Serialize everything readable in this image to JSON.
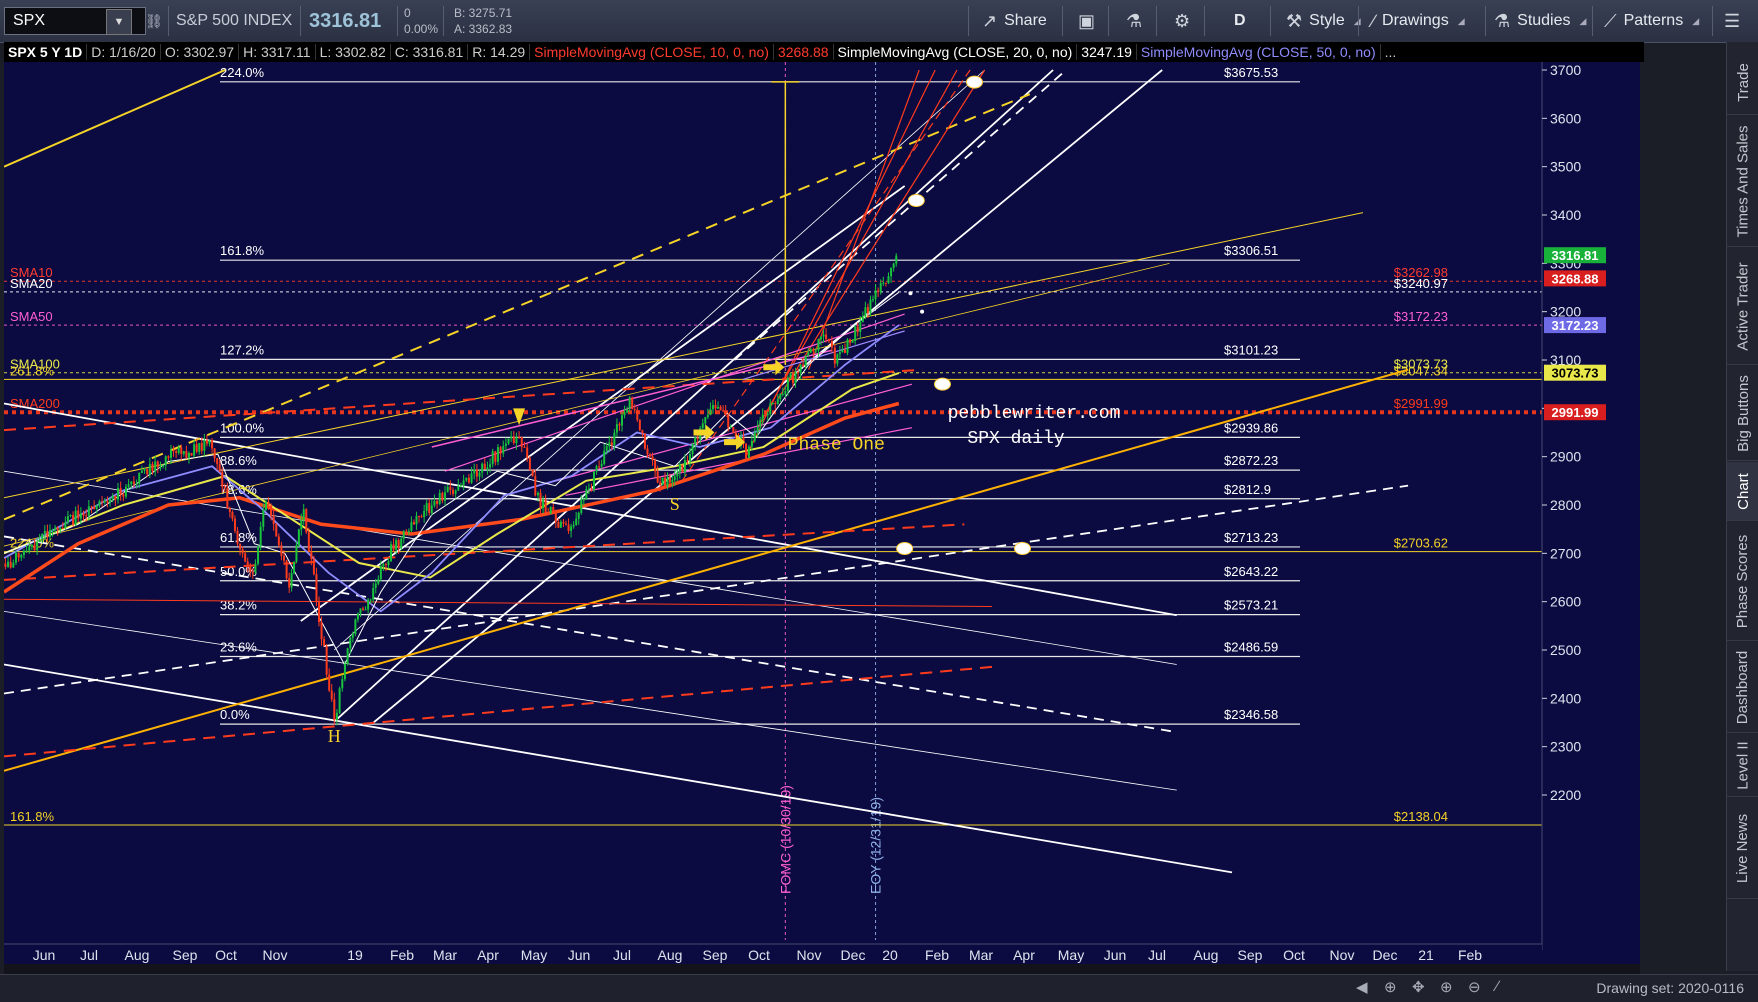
{
  "toolbar": {
    "symbol": "SPX",
    "index_name": "S&P 500 INDEX",
    "last": "3316.81",
    "net_change": "0",
    "pct_change": "0.00%",
    "bid": "B: 3275.71",
    "ask": "A: 3362.83",
    "share": "Share",
    "aggregation": "D",
    "style": "Style",
    "drawings": "Drawings",
    "studies": "Studies",
    "patterns": "Patterns"
  },
  "info": {
    "symbol_period": "SPX 5 Y 1D",
    "date": "D: 1/16/20",
    "open": "O: 3302.97",
    "high": "H: 3317.11",
    "low": "L: 3302.82",
    "close": "C: 3316.81",
    "range": "R: 14.29",
    "sma10_label": "SimpleMovingAvg (CLOSE, 10, 0, no)",
    "sma10_value": "3268.88",
    "sma20_label": "SimpleMovingAvg (CLOSE, 20, 0, no)",
    "sma20_value": "3247.19",
    "sma50_label": "SimpleMovingAvg (CLOSE, 50, 0, no)",
    "more": "..."
  },
  "side_tabs": [
    "Trade",
    "Times And Sales",
    "Active Trader",
    "Big Buttons",
    "Chart",
    "Phase Scores",
    "Dashboard",
    "Level II",
    "Live News"
  ],
  "active_side_tab": "Chart",
  "bottom": {
    "drawing_set": "Drawing set: 2020-0116"
  },
  "colors": {
    "background": "#0b0b41",
    "sma10": "#ff3b30",
    "sma20": "#ffffff",
    "sma50": "#8f8cff",
    "sma100": "#e8e84a",
    "sma200": "#ff4a1c",
    "fib": "#e8e8e8",
    "channel_yellow": "#f5d327",
    "channel_orange": "#ffb300",
    "trend_red": "#ff3b1c",
    "magenta": "#ff5fd2"
  },
  "chart_data": {
    "type": "candlestick",
    "title": "",
    "watermark": [
      "pebblewriter.com",
      "SPX daily"
    ],
    "y_axis_ticks": [
      2200,
      2300,
      2400,
      2500,
      2600,
      2700,
      2800,
      2900,
      3000,
      3100,
      3200,
      3300,
      3400,
      3500,
      3600,
      3700
    ],
    "y_axis_tick_labels": [
      "2200",
      "2300",
      "2400",
      "2500",
      "2600",
      "2700",
      "2800",
      "2900",
      "",
      "3100",
      "3200",
      "3300",
      "3400",
      "3500",
      "3600",
      "3700"
    ],
    "ylim": [
      2120,
      3730
    ],
    "x_axis_ticks": [
      "Jun",
      "Jul",
      "Aug",
      "Sep",
      "Oct",
      "Nov",
      "19",
      "Feb",
      "Mar",
      "Apr",
      "May",
      "Jun",
      "Jul",
      "Aug",
      "Sep",
      "Oct",
      "Nov",
      "Dec",
      "20",
      "Feb",
      "Mar",
      "Apr",
      "May",
      "Jun",
      "Jul",
      "Aug",
      "Sep",
      "Oct",
      "Nov",
      "Dec",
      "21",
      "Feb"
    ],
    "fib_levels": [
      {
        "label": "224.0%",
        "value": 3675.53,
        "value_label": "$3675.53"
      },
      {
        "label": "161.8%",
        "value": 3306.51,
        "value_label": "$3306.51"
      },
      {
        "label": "127.2%",
        "value": 3101.23,
        "value_label": "$3101.23"
      },
      {
        "label": "100.0%",
        "value": 2939.86,
        "value_label": "$2939.86"
      },
      {
        "label": "88.6%",
        "value": 2872.23,
        "value_label": "$2872.23"
      },
      {
        "label": "78.6%",
        "value": 2812.9,
        "value_label": "$2812.9"
      },
      {
        "label": "61.8%",
        "value": 2713.23,
        "value_label": "$2713.23"
      },
      {
        "label": "50.0%",
        "value": 2643.22,
        "value_label": "$2643.22"
      },
      {
        "label": "38.2%",
        "value": 2573.21,
        "value_label": "$2573.21"
      },
      {
        "label": "23.6%",
        "value": 2486.59,
        "value_label": "$2486.59"
      },
      {
        "label": "0.0%",
        "value": 2346.58,
        "value_label": "$2346.58"
      }
    ],
    "other_levels": [
      {
        "label": "261.8%",
        "value": 3060,
        "value_label": "$3047.34",
        "color": "#f5d327"
      },
      {
        "label": "224.0%",
        "value": 2703.62,
        "value_label": "$2703.62",
        "color": "#f5d327"
      },
      {
        "label": "161.8%",
        "value": 2138.04,
        "value_label": "$2138.04",
        "color": "#f5d327"
      }
    ],
    "sma_labels": [
      {
        "name": "SMA10",
        "value_label": "$3262.98",
        "value": 3262.98,
        "color": "#ff3b30"
      },
      {
        "name": "SMA20",
        "value_label": "$3240.97",
        "value": 3240.97,
        "color": "#ffffff"
      },
      {
        "name": "SMA50",
        "value_label": "$3172.23",
        "value": 3172.23,
        "color": "#ff5fd2"
      },
      {
        "name": "SMA100",
        "value_label": "$3073.73",
        "value": 3073.73,
        "color": "#e8e84a"
      },
      {
        "name": "SMA200",
        "value_label": "$2991.99",
        "value": 2991.99,
        "color": "#ff3b1c"
      }
    ],
    "price_badges": [
      {
        "text": "3316.81",
        "value": 3316.81,
        "bg": "#18b23a",
        "fg": "#ffffff"
      },
      {
        "text": "3268.88",
        "value": 3268.88,
        "bg": "#d81e1e",
        "fg": "#ffffff"
      },
      {
        "text": "3172.23",
        "value": 3172.23,
        "bg": "#6e6ae6",
        "fg": "#ffffff"
      },
      {
        "text": "3073.73",
        "value": 3073.73,
        "bg": "#e8e84a",
        "fg": "#000000"
      },
      {
        "text": "2991.99",
        "value": 2991.99,
        "bg": "#d81e1e",
        "fg": "#ffffff"
      }
    ],
    "event_markers": [
      {
        "label": "FOMC (10/30/19)",
        "date": "2019-10-30",
        "color": "#ff5fd2"
      },
      {
        "label": "EOY (12/31/19)",
        "date": "2019-12-31",
        "color": "#8fb0e8"
      }
    ],
    "annotations": [
      {
        "text": "Phase One",
        "date": "2019-10-11",
        "value": 2925
      },
      {
        "text": "H",
        "date": "2018-12-24",
        "value": 2310
      },
      {
        "text": "S",
        "date": "2019-08-15",
        "value": 2790
      }
    ],
    "close_series_points": [
      [
        "2018-05-01",
        2650
      ],
      [
        "2018-06-01",
        2720
      ],
      [
        "2018-07-01",
        2780
      ],
      [
        "2018-08-01",
        2830
      ],
      [
        "2018-09-01",
        2900
      ],
      [
        "2018-10-01",
        2925
      ],
      [
        "2018-10-15",
        2760
      ],
      [
        "2018-10-29",
        2650
      ],
      [
        "2018-11-07",
        2810
      ],
      [
        "2018-11-23",
        2640
      ],
      [
        "2018-12-03",
        2790
      ],
      [
        "2018-12-24",
        2351
      ],
      [
        "2019-01-04",
        2530
      ],
      [
        "2019-02-01",
        2705
      ],
      [
        "2019-03-01",
        2803
      ],
      [
        "2019-04-01",
        2870
      ],
      [
        "2019-04-30",
        2945
      ],
      [
        "2019-05-13",
        2812
      ],
      [
        "2019-06-03",
        2744
      ],
      [
        "2019-07-15",
        3014
      ],
      [
        "2019-08-05",
        2844
      ],
      [
        "2019-08-15",
        2850
      ],
      [
        "2019-09-12",
        3009
      ],
      [
        "2019-10-03",
        2910
      ],
      [
        "2019-10-11",
        2970
      ],
      [
        "2019-10-30",
        3046
      ],
      [
        "2019-11-27",
        3153
      ],
      [
        "2019-12-03",
        3093
      ],
      [
        "2019-12-31",
        3230
      ],
      [
        "2020-01-16",
        3316.81
      ]
    ]
  }
}
